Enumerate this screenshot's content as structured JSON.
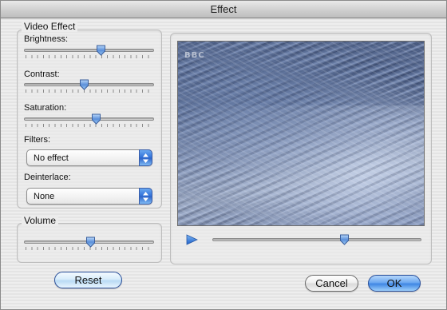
{
  "window": {
    "title": "Effect"
  },
  "video_effect": {
    "group_title": "Video Effect",
    "brightness": {
      "label": "Brightness:",
      "value": 0.59
    },
    "contrast": {
      "label": "Contrast:",
      "value": 0.46
    },
    "saturation": {
      "label": "Saturation:",
      "value": 0.55
    },
    "filters": {
      "label": "Filters:",
      "selected": "No effect"
    },
    "deinterlace": {
      "label": "Deinterlace:",
      "selected": "None"
    }
  },
  "volume": {
    "group_title": "Volume",
    "value": 0.51
  },
  "preview": {
    "logo_text": "BBC",
    "position": 0.63
  },
  "buttons": {
    "reset": "Reset",
    "cancel": "Cancel",
    "ok": "OK"
  },
  "colors": {
    "accent": "#3f86e4",
    "thumb": "#5b8fd9"
  },
  "icons": {
    "play": "play-icon",
    "popup_arrows": "updown-arrows-icon"
  }
}
